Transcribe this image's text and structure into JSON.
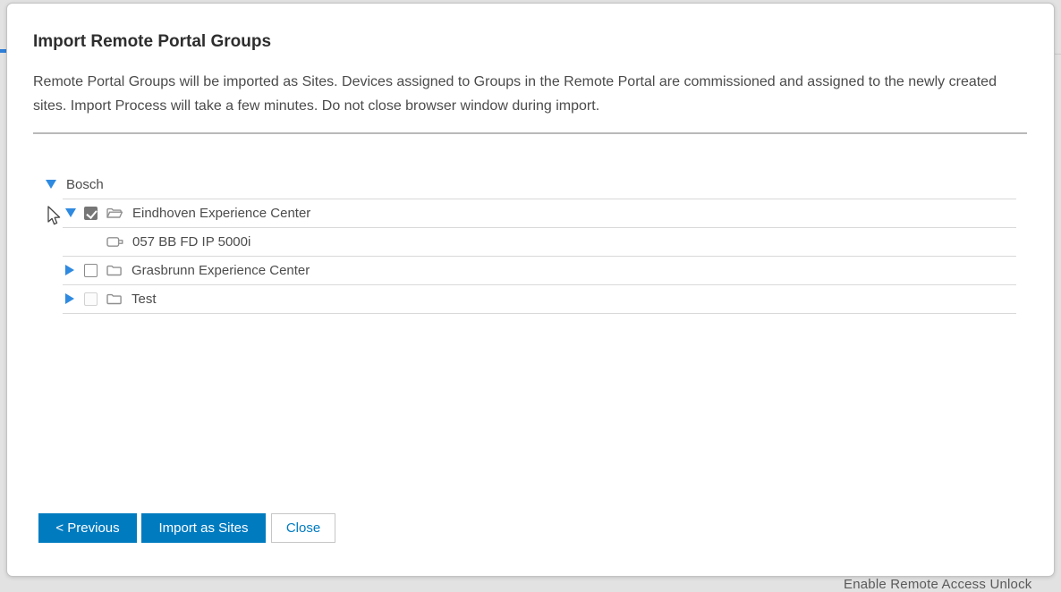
{
  "background": {
    "footer_partial_text": "Enable Remote Access Unlock"
  },
  "dialog": {
    "title": "Import Remote Portal Groups",
    "description": "Remote Portal Groups will be imported as Sites. Devices assigned to Groups in the Remote Portal are commissioned and assigned to the newly created sites. Import Process will take a few minutes. Do not close browser window during import.",
    "buttons": {
      "previous": "< Previous",
      "import_as_sites": "Import as Sites",
      "close": "Close"
    }
  },
  "tree": {
    "root": {
      "label": "Bosch",
      "state": "expanded"
    },
    "groups": [
      {
        "label": "Eindhoven Experience Center",
        "state": "expanded",
        "checked": true,
        "disabled": false,
        "icon": "folder-open-icon",
        "devices": [
          {
            "label": "057 BB FD IP 5000i",
            "icon": "camera-icon"
          }
        ]
      },
      {
        "label": "Grasbrunn Experience Center",
        "state": "collapsed",
        "checked": false,
        "disabled": false,
        "icon": "folder-icon",
        "devices": []
      },
      {
        "label": "Test",
        "state": "collapsed",
        "checked": false,
        "disabled": true,
        "icon": "folder-icon",
        "devices": []
      }
    ]
  },
  "colors": {
    "primary_button_blue": "#007bc0",
    "tree_arrow_blue": "#2e8ae0",
    "checkbox_checked_gray": "#767676",
    "page_background_gray": "#e2e2e2"
  }
}
